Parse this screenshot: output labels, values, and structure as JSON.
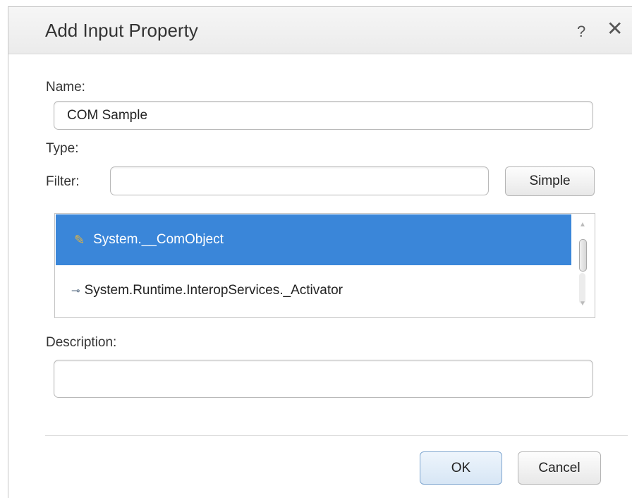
{
  "dialog": {
    "title": "Add Input Property",
    "help_label": "?",
    "close_label": "✕"
  },
  "name_field": {
    "label": "Name:",
    "value": "COM Sample"
  },
  "type_section": {
    "label": "Type:",
    "filter_label": "Filter:",
    "filter_value": "",
    "simple_button": "Simple"
  },
  "type_list": {
    "items": [
      {
        "icon": "class-icon",
        "label": "System.__ComObject",
        "selected": true
      },
      {
        "icon": "interface-icon",
        "label": "System.Runtime.InteropServices._Activator",
        "selected": false
      }
    ]
  },
  "description_field": {
    "label": "Description:",
    "value": ""
  },
  "footer": {
    "ok_button": "OK",
    "cancel_button": "Cancel"
  },
  "colors": {
    "selection": "#3a86d9",
    "title_bar": "#efefef"
  }
}
